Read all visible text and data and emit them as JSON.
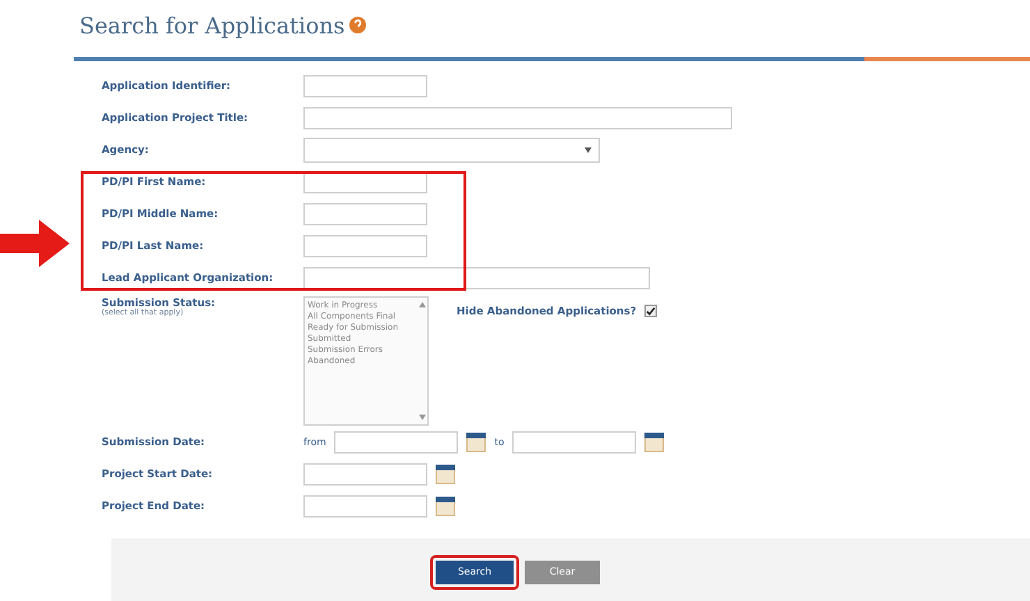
{
  "title": "Search for Applications",
  "fields": [
    {
      "kind": "short",
      "label": "Application Identifier:"
    },
    {
      "kind": "long",
      "label": "Application Project Title:"
    },
    {
      "kind": "select",
      "label": "Agency:"
    },
    {
      "kind": "short",
      "label": "PD/PI First Name:"
    },
    {
      "kind": "short",
      "label": "PD/PI Middle Name:"
    },
    {
      "kind": "short",
      "label": "PD/PI Last Name:"
    },
    {
      "kind": "medium",
      "label": "Lead Applicant Organization:"
    },
    {
      "kind": "listbox",
      "label": "Submission Status:",
      "hint": "(select all that apply)",
      "options": [
        "Work in Progress",
        "All Components Final",
        "Ready for Submission",
        "Submitted",
        "Submission Errors",
        "Abandoned"
      ],
      "check_label": "Hide Abandoned Applications?",
      "checked": true
    },
    {
      "kind": "daterange",
      "label": "Submission Date:",
      "from": "from",
      "to": "to"
    },
    {
      "kind": "date",
      "label": "Project Start Date:"
    },
    {
      "kind": "date",
      "label": "Project End Date:"
    }
  ],
  "buttons": [
    {
      "label": "Search",
      "kind": "primary"
    },
    {
      "label": "Clear",
      "kind": "secondary"
    }
  ]
}
